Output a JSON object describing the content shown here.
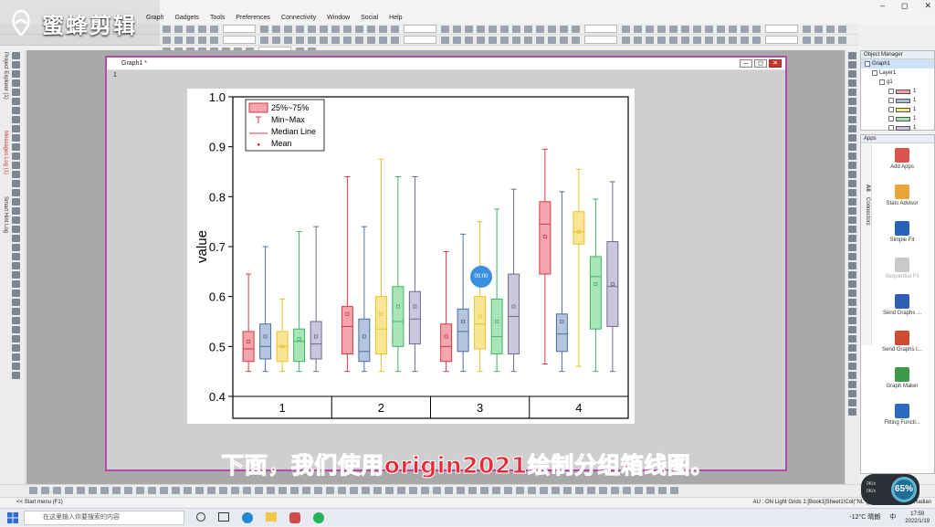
{
  "logo": {
    "text": "蜜蜂剪辑"
  },
  "menu": [
    "Graph",
    "Gadgets",
    "Tools",
    "Preferences",
    "Connectivity",
    "Window",
    "Social",
    "Help"
  ],
  "window_controls": {
    "min": "–",
    "max": "◻",
    "close": "✕"
  },
  "left_tabs": [
    "Project Explorer (1)",
    "Messages Log (1)",
    "Smart Hint Log"
  ],
  "graph_window": {
    "title": "Graph1 *",
    "layer_number": "1"
  },
  "object_manager": {
    "title": "Object Manager",
    "items": [
      {
        "label": "Graph1",
        "level": 0
      },
      {
        "label": "Layer1",
        "level": 1
      },
      {
        "label": "g1",
        "level": 2
      }
    ],
    "series": [
      {
        "label": "1",
        "color": "#f0a0a8"
      },
      {
        "label": "1",
        "color": "#a8bcd6"
      },
      {
        "label": "1",
        "color": "#f7e48a"
      },
      {
        "label": "1",
        "color": "#a6e3b4"
      },
      {
        "label": "1",
        "color": "#c8c3dc"
      }
    ]
  },
  "apps_panel": {
    "title": "Apps",
    "tabs": [
      "All",
      "Connectors"
    ],
    "items": [
      {
        "label": "Add Apps",
        "icon": "add-apps-icon",
        "color": "#d9544d"
      },
      {
        "label": "Stats Advisor",
        "icon": "wand-icon",
        "color": "#e8a73a"
      },
      {
        "label": "Simple Fit",
        "icon": "simple-fit-icon",
        "color": "#2463b5"
      },
      {
        "label": "Sequential Fit",
        "icon": "sequential-fit-icon",
        "color": "#c9c9c9"
      },
      {
        "label": "Send Graphs ...",
        "icon": "send-graphs-word-icon",
        "color": "#2d5fb5"
      },
      {
        "label": "Send Graphs t...",
        "icon": "send-graphs-ppt-icon",
        "color": "#d04b34"
      },
      {
        "label": "Graph Maker",
        "icon": "graph-maker-icon",
        "color": "#3d9a4a"
      },
      {
        "label": "Fitting Functi...",
        "icon": "fitting-functions-icon",
        "color": "#2a6bbf"
      }
    ]
  },
  "chart_data": {
    "type": "box",
    "ylabel": "value",
    "ylim": [
      0.4,
      1.0
    ],
    "yticks": [
      "0.4",
      "0.5",
      "0.6",
      "0.7",
      "0.8",
      "0.9",
      "1.0"
    ],
    "categories": [
      "1",
      "2",
      "3",
      "4"
    ],
    "legend": {
      "position": "top-left",
      "entries": [
        "25%~75%",
        "Min~Max",
        "Median Line",
        "Mean"
      ]
    },
    "series_colors": [
      {
        "fill": "#f4a5ad",
        "stroke": "#d43a46"
      },
      {
        "fill": "#b4c5de",
        "stroke": "#4d6f9c"
      },
      {
        "fill": "#f9e694",
        "stroke": "#e6c22c"
      },
      {
        "fill": "#a9e6b7",
        "stroke": "#3fb264"
      },
      {
        "fill": "#cbc6de",
        "stroke": "#6e6a8a"
      }
    ],
    "groups": [
      {
        "category": "1",
        "boxes": [
          {
            "min": 0.45,
            "q1": 0.47,
            "median": 0.495,
            "q3": 0.53,
            "max": 0.645,
            "mean": 0.51
          },
          {
            "min": 0.45,
            "q1": 0.475,
            "median": 0.5,
            "q3": 0.545,
            "max": 0.7,
            "mean": 0.52
          },
          {
            "min": 0.45,
            "q1": 0.47,
            "median": 0.5,
            "q3": 0.53,
            "max": 0.595,
            "mean": 0.5
          },
          {
            "min": 0.45,
            "q1": 0.47,
            "median": 0.51,
            "q3": 0.535,
            "max": 0.73,
            "mean": 0.515
          },
          {
            "min": 0.45,
            "q1": 0.475,
            "median": 0.505,
            "q3": 0.55,
            "max": 0.74,
            "mean": 0.52
          }
        ]
      },
      {
        "category": "2",
        "boxes": [
          {
            "min": 0.45,
            "q1": 0.485,
            "median": 0.54,
            "q3": 0.58,
            "max": 0.84,
            "mean": 0.565
          },
          {
            "min": 0.45,
            "q1": 0.47,
            "median": 0.49,
            "q3": 0.555,
            "max": 0.74,
            "mean": 0.52
          },
          {
            "min": 0.45,
            "q1": 0.485,
            "median": 0.535,
            "q3": 0.6,
            "max": 0.875,
            "mean": 0.565
          },
          {
            "min": 0.45,
            "q1": 0.5,
            "median": 0.55,
            "q3": 0.62,
            "max": 0.84,
            "mean": 0.58
          },
          {
            "min": 0.45,
            "q1": 0.505,
            "median": 0.555,
            "q3": 0.61,
            "max": 0.84,
            "mean": 0.58
          }
        ]
      },
      {
        "category": "3",
        "boxes": [
          {
            "min": 0.45,
            "q1": 0.47,
            "median": 0.5,
            "q3": 0.545,
            "max": 0.69,
            "mean": 0.52
          },
          {
            "min": 0.45,
            "q1": 0.49,
            "median": 0.53,
            "q3": 0.575,
            "max": 0.725,
            "mean": 0.55
          },
          {
            "min": 0.45,
            "q1": 0.495,
            "median": 0.545,
            "q3": 0.6,
            "max": 0.75,
            "mean": 0.56
          },
          {
            "min": 0.45,
            "q1": 0.485,
            "median": 0.52,
            "q3": 0.595,
            "max": 0.775,
            "mean": 0.55
          },
          {
            "min": 0.45,
            "q1": 0.485,
            "median": 0.56,
            "q3": 0.645,
            "max": 0.815,
            "mean": 0.58
          }
        ]
      },
      {
        "category": "4",
        "boxes": [
          {
            "min": 0.465,
            "q1": 0.645,
            "median": 0.745,
            "q3": 0.79,
            "max": 0.895,
            "mean": 0.72
          },
          {
            "min": 0.45,
            "q1": 0.49,
            "median": 0.525,
            "q3": 0.565,
            "max": 0.81,
            "mean": 0.55
          },
          {
            "min": 0.46,
            "q1": 0.705,
            "median": 0.73,
            "q3": 0.77,
            "max": 0.855,
            "mean": 0.73
          },
          {
            "min": 0.45,
            "q1": 0.535,
            "median": 0.64,
            "q3": 0.68,
            "max": 0.795,
            "mean": 0.625
          },
          {
            "min": 0.45,
            "q1": 0.54,
            "median": 0.62,
            "q3": 0.71,
            "max": 0.83,
            "mean": 0.625
          }
        ]
      }
    ]
  },
  "timer_badge": "00:00",
  "subtitle": "下面，我们使用origin2021绘制分组箱线图。",
  "statusbar": {
    "start_menu": "<< Start menu (F1)",
    "status_text": "AU : ON  Light Grids  1:[Book1]Sheet1!Col(\"NL\")[1:*]  1:[Graph1]1!1  Radian"
  },
  "taskbar": {
    "search_placeholder": "在这里输入你要搜索的内容",
    "weather": "-12°C  晴朗",
    "ime": "中",
    "time": "17:59",
    "date": "2022/1/19"
  },
  "net_widget": {
    "percent": "65%",
    "up": "0K/s",
    "down": "0K/s"
  }
}
